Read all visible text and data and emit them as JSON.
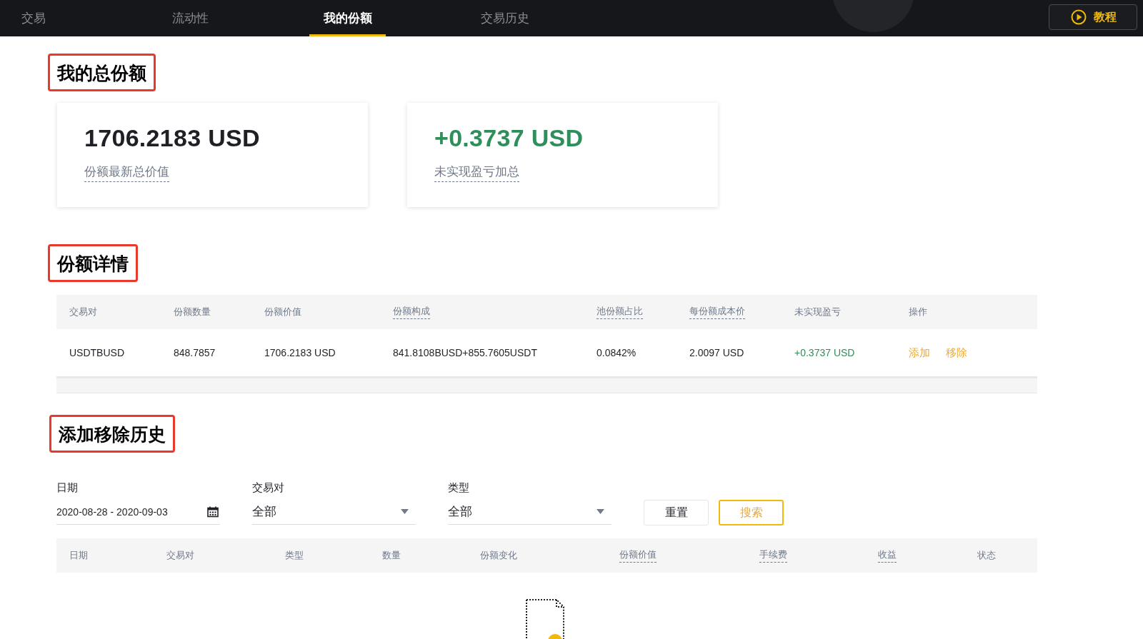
{
  "nav": {
    "tabs": [
      {
        "label": "交易",
        "selected": false
      },
      {
        "label": "流动性",
        "selected": false
      },
      {
        "label": "我的份额",
        "selected": true
      },
      {
        "label": "交易历史",
        "selected": false
      }
    ],
    "tutorial_button": "教程"
  },
  "total_section": {
    "title": "我的总份额",
    "outlined": true,
    "cards": [
      {
        "value": "1706.2183 USD",
        "label": "份额最新总价值",
        "gain": false
      },
      {
        "value": "+0.3737 USD",
        "label": "未实现盈亏加总",
        "gain": true
      }
    ]
  },
  "detail_section": {
    "title": "份额详情",
    "outlined": true,
    "table": {
      "columns": [
        {
          "label": "交易对",
          "dashed_hint": false,
          "kind": "text"
        },
        {
          "label": "份额数量",
          "dashed_hint": false,
          "kind": "text"
        },
        {
          "label": "份额价值",
          "dashed_hint": false,
          "kind": "text"
        },
        {
          "label": "份额构成",
          "dashed_hint": true,
          "kind": "text"
        },
        {
          "label": "池份额占比",
          "dashed_hint": true,
          "kind": "text"
        },
        {
          "label": "每份额成本价",
          "dashed_hint": true,
          "kind": "text"
        },
        {
          "label": "未实现盈亏",
          "dashed_hint": false,
          "kind": "pnl"
        },
        {
          "label": "操作",
          "dashed_hint": false,
          "kind": "actions"
        }
      ],
      "rows": [
        {
          "cells": [
            "USDTBUSD",
            "848.7857",
            "1706.2183 USD",
            "841.8108BUSD+855.7605USDT",
            "0.0842%",
            "2.0097 USD",
            "+0.3737 USD",
            [
              "添加",
              "移除"
            ]
          ]
        }
      ]
    }
  },
  "history_section": {
    "title": "添加移除历史",
    "outlined": true,
    "filters": [
      {
        "kind": "date",
        "label": "日期",
        "value": "2020-08-28 - 2020-09-03"
      },
      {
        "kind": "select",
        "label": "交易对",
        "value": "全部"
      },
      {
        "kind": "select",
        "label": "类型",
        "value": "全部"
      }
    ],
    "buttons": [
      {
        "label": "重置",
        "kind": "secondary"
      },
      {
        "label": "搜索",
        "kind": "primary"
      }
    ],
    "table": {
      "columns": [
        {
          "label": "日期",
          "dashed_hint": false
        },
        {
          "label": "交易对",
          "dashed_hint": false
        },
        {
          "label": "类型",
          "dashed_hint": false
        },
        {
          "label": "数量",
          "dashed_hint": false
        },
        {
          "label": "份额变化",
          "dashed_hint": false
        },
        {
          "label": "份额价值",
          "dashed_hint": true
        },
        {
          "label": "手续费",
          "dashed_hint": true
        },
        {
          "label": "收益",
          "dashed_hint": true
        },
        {
          "label": "状态",
          "dashed_hint": false
        }
      ]
    }
  }
}
